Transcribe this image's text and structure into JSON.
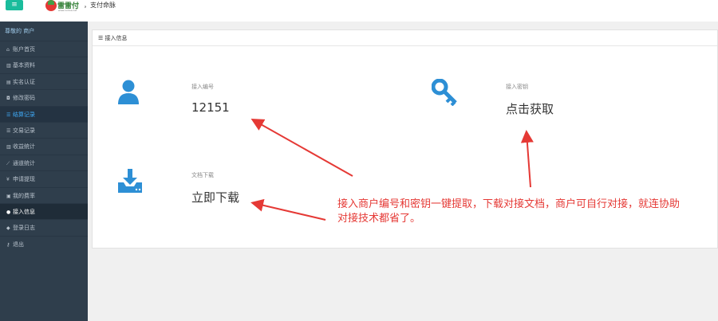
{
  "topbar": {
    "menu_icon": "hamburger-icon",
    "logo_name": "雷雷付",
    "logo_slogan": "，支付命脉",
    "logo_url": "www.ruidus.net"
  },
  "sidebar": {
    "header": "尊敬的 商户",
    "items": [
      {
        "icon": "home-icon",
        "glyph": "⌂",
        "label": "账户首页"
      },
      {
        "icon": "chart-icon",
        "glyph": "▥",
        "label": "基本资料"
      },
      {
        "icon": "id-card-icon",
        "glyph": "▤",
        "label": "实名认证"
      },
      {
        "icon": "lock-icon",
        "glyph": "◘",
        "label": "修改密码"
      },
      {
        "icon": "list-icon",
        "glyph": "☰",
        "label": "结算记录"
      },
      {
        "icon": "list-icon",
        "glyph": "☰",
        "label": "交易记录"
      },
      {
        "icon": "bar-chart-icon",
        "glyph": "▥",
        "label": "收益统计"
      },
      {
        "icon": "line-chart-icon",
        "glyph": "⟋",
        "label": "通道统计"
      },
      {
        "icon": "yen-icon",
        "glyph": "¥",
        "label": "申请提现"
      },
      {
        "icon": "card-icon",
        "glyph": "▣",
        "label": "我的费率"
      },
      {
        "icon": "info-icon",
        "glyph": "●",
        "label": "接入信息"
      },
      {
        "icon": "tag-icon",
        "glyph": "◆",
        "label": "登录日志"
      },
      {
        "icon": "key-icon",
        "glyph": "⚷",
        "label": "退出"
      }
    ]
  },
  "panel": {
    "header_icon": "list-icon",
    "title": "接入信息"
  },
  "fields": {
    "merchant_id": {
      "icon": "user-icon",
      "label": "接入编号",
      "value": "12151"
    },
    "secret_key": {
      "icon": "key-icon",
      "label": "接入密钥",
      "value": "点击获取"
    },
    "doc_download": {
      "icon": "download-icon",
      "label": "文档下载",
      "value": "立即下载"
    }
  },
  "annotation": {
    "line1": "接入商户编号和密钥一键提取，下载对接文档，商户可自行对接，就连协助",
    "line2": "对接技术都省了。"
  },
  "colors": {
    "sidebar_bg": "#2f3e4c",
    "accent_teal": "#1abc9c",
    "icon_blue": "#2d8fd5",
    "annotation_red": "#e53935"
  }
}
